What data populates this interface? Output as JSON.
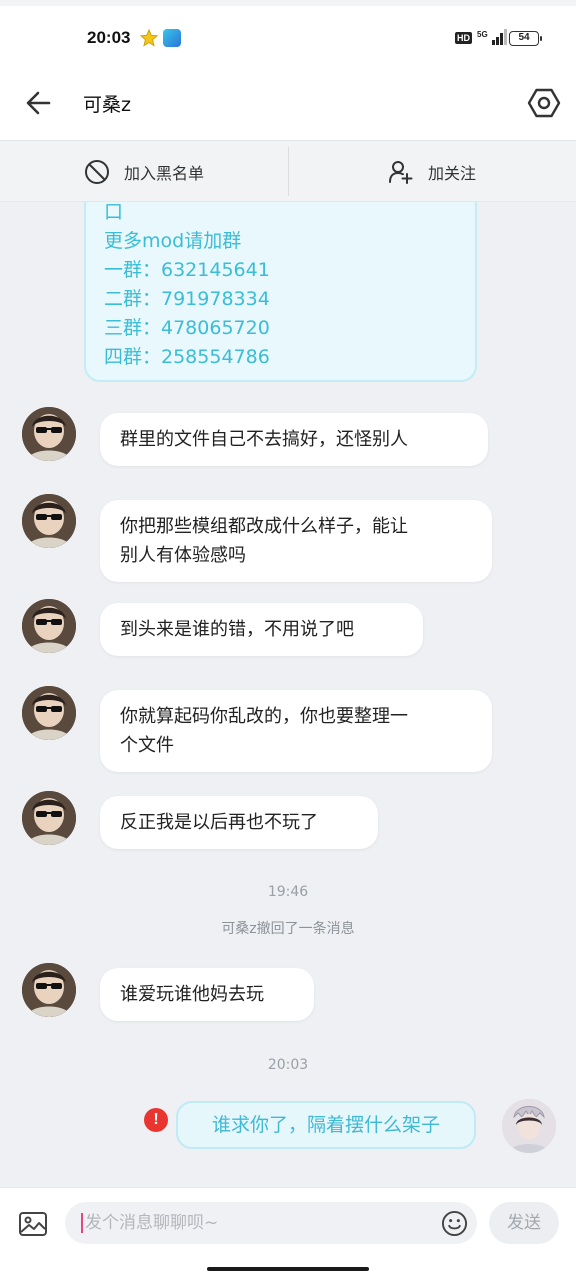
{
  "status_bar": {
    "time": "20:03",
    "hd": "HD",
    "battery": "54"
  },
  "header": {
    "title": "可桑z"
  },
  "actions": {
    "blacklist": "加入黑名单",
    "follow": "加关注"
  },
  "notice": {
    "lines": [
      "口",
      "更多mod请加群",
      "一群：632145641",
      "二群：791978334",
      "三群：478065720",
      "四群：258554786"
    ]
  },
  "messages": [
    {
      "lines": [
        "群里的文件自己不去搞好，还怪别人"
      ]
    },
    {
      "lines": [
        "你把那些模组都改成什么样子，能让",
        "别人有体验感吗"
      ]
    },
    {
      "lines": [
        "到头来是谁的错，不用说了吧"
      ]
    },
    {
      "lines": [
        "你就算起码你乱改的，你也要整理一",
        "个文件"
      ]
    },
    {
      "lines": [
        "反正我是以后再也不玩了"
      ]
    },
    {
      "lines": [
        "谁爱玩谁他妈去玩"
      ]
    }
  ],
  "timestamps": [
    "19:46",
    "20:03"
  ],
  "recall_notice": "可桑z撤回了一条消息",
  "my_message": {
    "text": "谁求你了，隔着摆什么架子",
    "status": "!"
  },
  "input": {
    "placeholder": "发个消息聊聊呗~",
    "send_label": "发送"
  },
  "colors": {
    "accent": "#3bbdd6",
    "error": "#e8352f",
    "bubble_me": "#e6f7fc"
  },
  "icons": {
    "back": "arrow-left-icon",
    "settings": "hexagon-gear-icon",
    "blacklist": "ban-icon",
    "follow": "add-user-icon",
    "image": "image-icon",
    "emoji": "smiley-icon"
  }
}
